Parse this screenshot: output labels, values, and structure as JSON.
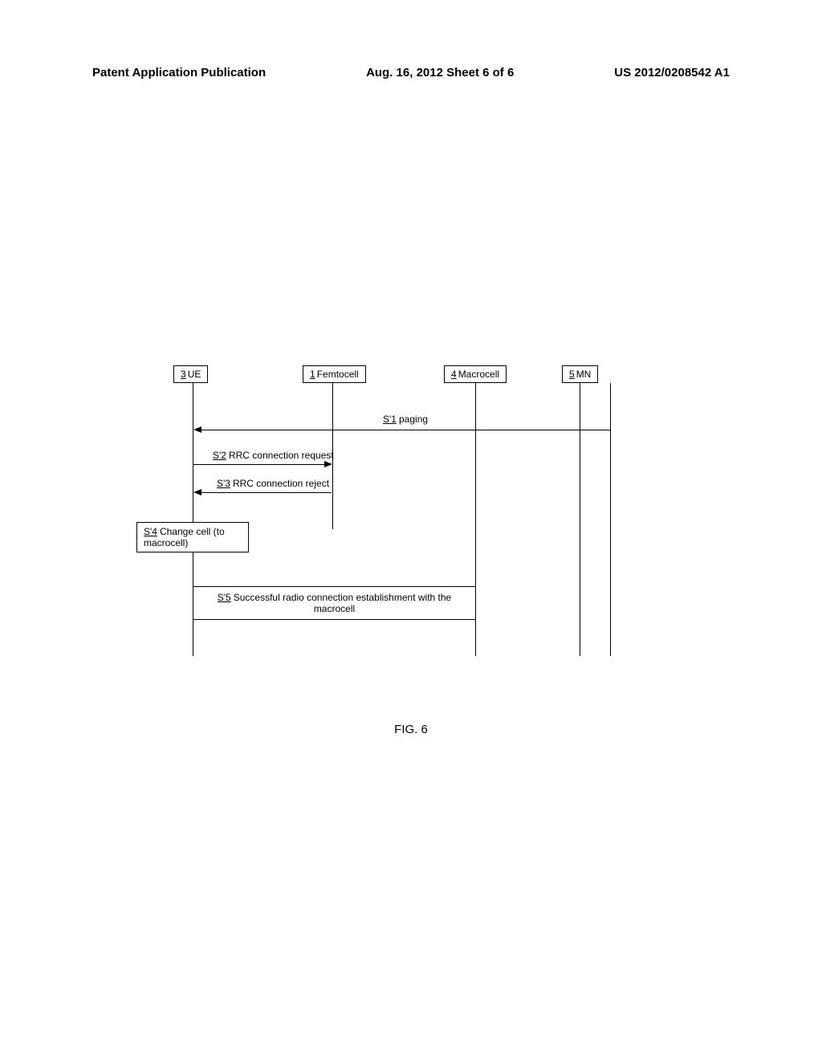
{
  "header": {
    "left": "Patent Application Publication",
    "center": "Aug. 16, 2012  Sheet 6 of 6",
    "right": "US 2012/0208542 A1"
  },
  "actors": {
    "ue": {
      "num": "3",
      "label": "UE"
    },
    "femtocell": {
      "num": "1",
      "label": "Femtocell"
    },
    "macrocell": {
      "num": "4",
      "label": "Macrocell"
    },
    "mn": {
      "num": "5",
      "label": "MN"
    }
  },
  "messages": {
    "s1": {
      "num": "S'1",
      "label": "paging"
    },
    "s2": {
      "num": "S'2",
      "label": "RRC connection request"
    },
    "s3": {
      "num": "S'3",
      "label": "RRC connection reject"
    },
    "s4": {
      "num": "S'4",
      "label_line1": "Change cell (to",
      "label_line2": "macrocell)"
    },
    "s5": {
      "num": "S'5",
      "label_line1": "Successful radio connection establishment with the",
      "label_line2": "macrocell"
    }
  },
  "figure_caption": "FIG. 6"
}
